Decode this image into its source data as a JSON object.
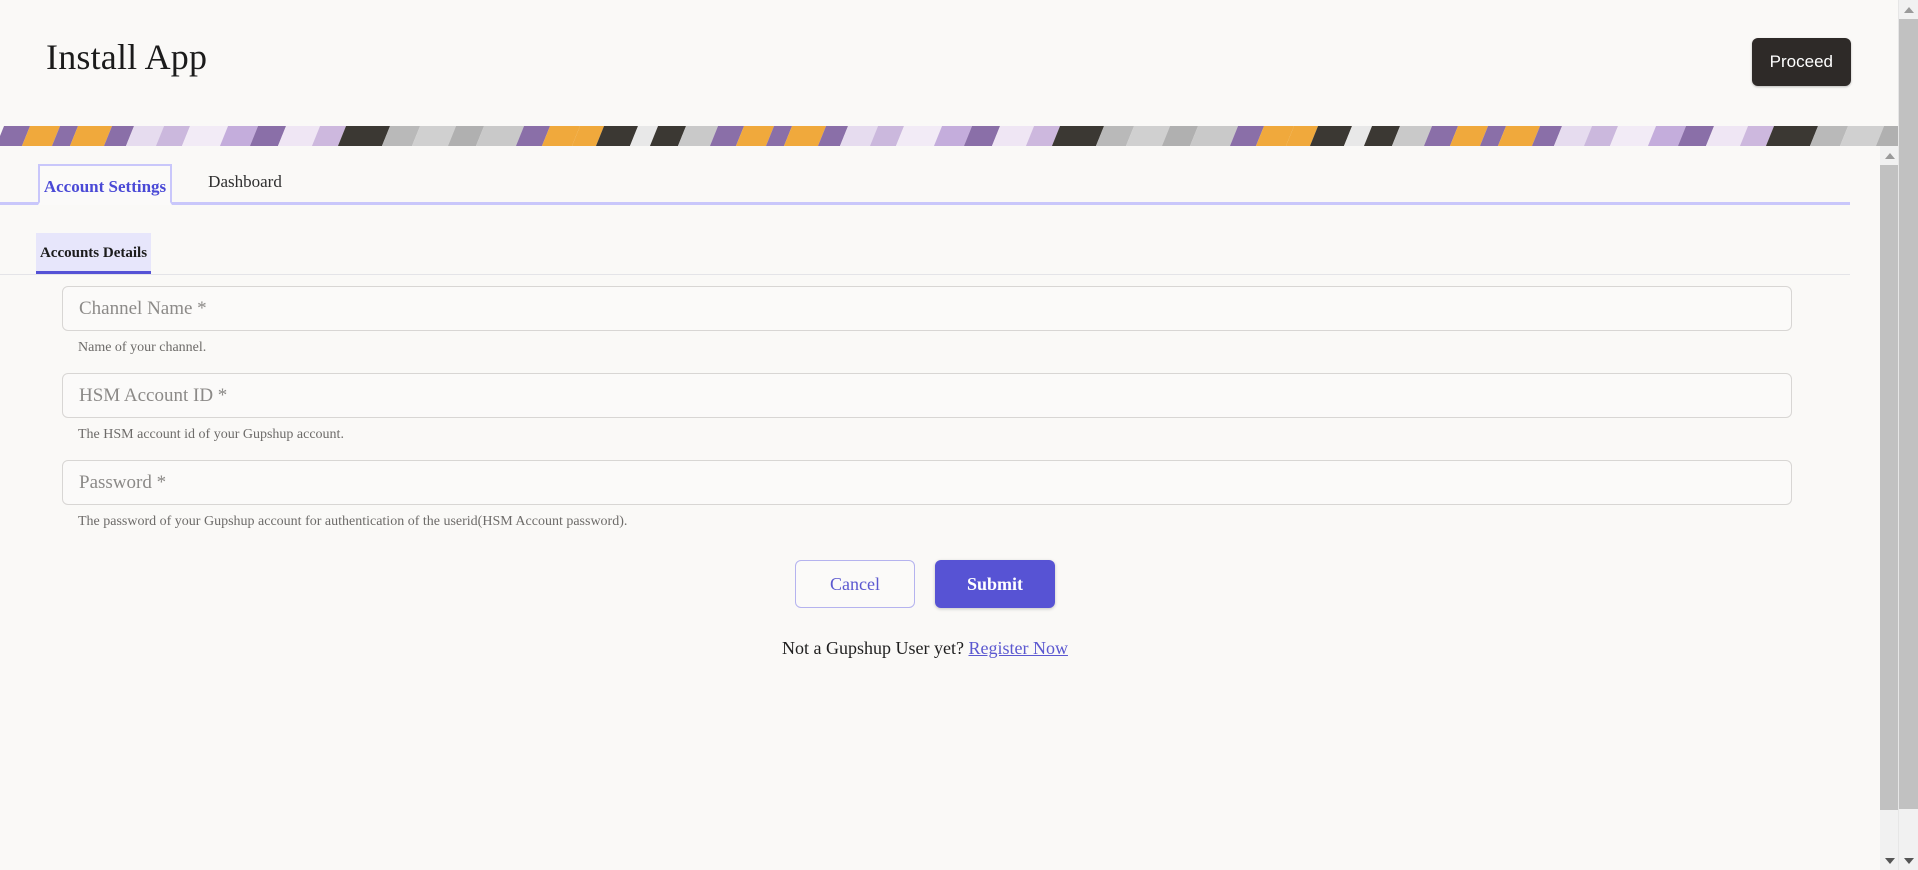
{
  "header": {
    "title": "Install App",
    "proceed_label": "Proceed"
  },
  "banner": {
    "colors": [
      "#8a6fa8",
      "#f0a93c",
      "#8a6fa8",
      "#f0a93c",
      "#8a6fa8",
      "#e6dcef",
      "#cbb8dd",
      "#f2ebf6",
      "#c4addc",
      "#8a6fa8",
      "#efe6f4",
      "#cdb8de",
      "#3b3833",
      "#b9b9b9",
      "#d0d0d0",
      "#b0b0b0",
      "#c9c9c9",
      "#8a6fa8",
      "#f0a93c",
      "#f0a93c",
      "#3b3833",
      "#e8e8e8",
      "#3b3833",
      "#c9c9c9"
    ]
  },
  "tabs": {
    "items": [
      {
        "label": "Account Settings",
        "active": true
      },
      {
        "label": "Dashboard",
        "active": false
      }
    ]
  },
  "subtab": {
    "label": "Accounts Details"
  },
  "form": {
    "fields": [
      {
        "name": "channel-name",
        "placeholder": "Channel Name *",
        "value": "",
        "helper": "Name of your channel."
      },
      {
        "name": "hsm-account-id",
        "placeholder": "HSM Account ID *",
        "value": "",
        "helper": "The HSM account id of your Gupshup account."
      },
      {
        "name": "password",
        "placeholder": "Password *",
        "value": "",
        "helper": "The password of your Gupshup account for authentication of the userid(HSM Account password)."
      }
    ],
    "cancel_label": "Cancel",
    "submit_label": "Submit",
    "register_prompt": "Not a Gupshup User yet?",
    "register_link_label": "Register Now"
  },
  "colors": {
    "accent_purple": "#5753d4",
    "tab_border": "#c9c7fb",
    "subtab_bg": "#e7e6fb",
    "page_bg": "#faf9f7",
    "proceed_bg": "#2e2a28"
  }
}
